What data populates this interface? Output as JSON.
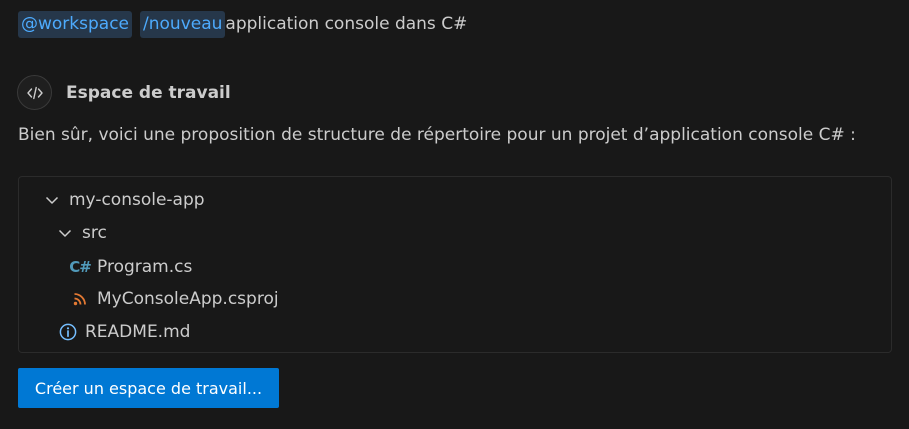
{
  "query": {
    "mention_workspace": "@workspace",
    "mention_command": "/nouveau",
    "text": "application console dans C#"
  },
  "agent": {
    "icon": "code-icon",
    "name": "Espace de travail"
  },
  "message": "Bien sûr, voici une proposition de structure de répertoire pour un projet d’application console C# :",
  "tree": {
    "items": [
      {
        "label": "my-console-app",
        "icon": "chevron-down-icon",
        "depth": 0
      },
      {
        "label": "src",
        "icon": "chevron-down-icon",
        "depth": 1
      },
      {
        "label": "Program.cs",
        "icon": "csharp-file-icon",
        "depth": 2
      },
      {
        "label": "MyConsoleApp.csproj",
        "icon": "rss-file-icon",
        "depth": 2
      },
      {
        "label": "README.md",
        "icon": "info-icon",
        "depth": 1
      }
    ]
  },
  "actions": {
    "create_label": "Créer un espace de travail..."
  },
  "colors": {
    "background": "#181818",
    "mention_bg": "#26374a",
    "mention_fg": "#4daafc",
    "button_bg": "#0078d4",
    "csharp_icon": "#519aba",
    "rss_icon": "#e37933",
    "info_icon": "#75beff"
  }
}
